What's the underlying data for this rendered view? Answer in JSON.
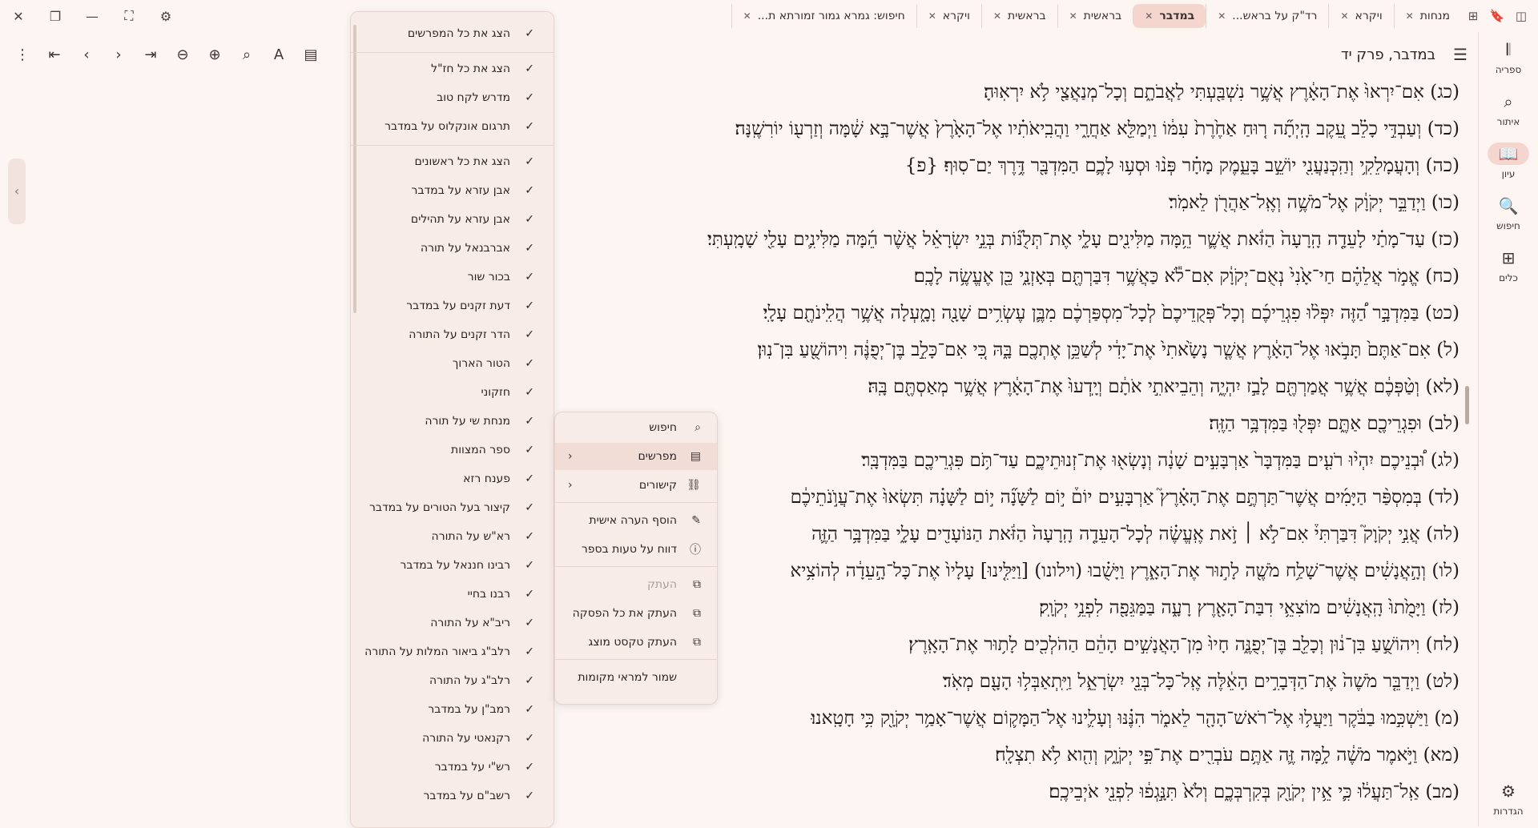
{
  "window": {
    "close": "✕",
    "restore": "❐",
    "minimize": "—",
    "fullscreen": "⛶",
    "settings": "⚙"
  },
  "tabbar": {
    "icons": [
      {
        "name": "sidebar-toggle-icon",
        "glyph": "◫"
      },
      {
        "name": "bookmark-icon",
        "glyph": "🔖"
      },
      {
        "name": "new-tab-icon",
        "glyph": "⊞"
      }
    ],
    "tabs": [
      {
        "label": "מנחות",
        "active": false
      },
      {
        "label": "ויקרא",
        "active": false
      },
      {
        "label": "רד\"ק על בראש...",
        "active": false
      },
      {
        "label": "במדבר",
        "active": true
      },
      {
        "label": "בראשית",
        "active": false
      },
      {
        "label": "בראשית",
        "active": false
      },
      {
        "label": "ויקרא",
        "active": false
      },
      {
        "label": "חיפוש: גמרא גמור זמורתא ת...",
        "active": false
      }
    ]
  },
  "rail": {
    "items": [
      {
        "label": "ספריה",
        "icon": "library-icon",
        "glyph": "𝄃",
        "active": false
      },
      {
        "label": "איתור",
        "icon": "locate-icon",
        "glyph": "⌕",
        "active": false
      },
      {
        "label": "עיון",
        "icon": "book-open-icon",
        "glyph": "📖",
        "active": true
      },
      {
        "label": "חיפוש",
        "icon": "search-icon",
        "glyph": "🔍",
        "active": false
      },
      {
        "label": "כלים",
        "icon": "tools-icon",
        "glyph": "⊞",
        "active": false
      }
    ],
    "settings": {
      "label": "הגדרות",
      "icon": "gear-icon",
      "glyph": "⚙"
    }
  },
  "toolbar": {
    "title": "במדבר, פרק יד",
    "menu_glyph": "☰",
    "left_icons": [
      {
        "name": "more-options-icon",
        "glyph": "⋮"
      },
      {
        "name": "first-page-icon",
        "glyph": "⇤"
      },
      {
        "name": "previous-icon",
        "glyph": "‹"
      },
      {
        "name": "next-icon",
        "glyph": "›"
      },
      {
        "name": "last-page-icon",
        "glyph": "⇥"
      },
      {
        "name": "zoom-out-icon",
        "glyph": "⊖"
      },
      {
        "name": "zoom-in-icon",
        "glyph": "⊕"
      },
      {
        "name": "search-icon",
        "glyph": "⌕"
      },
      {
        "name": "text-style-icon",
        "glyph": "A"
      },
      {
        "name": "panel-toggle-icon",
        "glyph": "▤"
      }
    ]
  },
  "verses": [
    "(כג) אִם־יִרְאוּ֙ אֶת־הָאָ֔רֶץ אֲשֶׁ֥ר נִשְׁבַּ֖עְתִּי לַאֲבֹתָ֑ם וְכָל־מְנַאֲצַ֖י לֹ֥א יִרְאֽוּהָ׃",
    "(כד) וְעַבְדִּ֣י כָלֵ֗ב עֵ֚קֶב הָֽיְתָ֞ה ר֤וּחַ אַחֶ֙רֶת֙ עִמּ֔וֹ וַיְמַלֵּ֖א אַחֲרָ֑י וַהֲבִֽיאֹתִ֗יו אֶל־הָאָ֙רֶץ֙ אֲשֶׁר־בָּ֣א שָׁ֔מָּה וְזַרְע֖וֹ יוֹרִשֶֽׁנָּה׃",
    "(כה) וְהָעֲמָלֵקִ֥י וְהַֽכְּנַעֲנִ֖י יוֹשֵׁ֣ב בָּעֵ֑מֶק מָחָ֗ר פְּנ֨וּ וּסְע֥וּ לָכֶ֛ם הַמִּדְבָּ֖ר דֶּ֥רֶךְ יַם־סֽוּף׃ {פ}",
    "(כו) וַיְדַבֵּ֣ר יְקֹוָ֔ק אֶל־מֹשֶׁ֥ה וְאֶֽל־אַהֲרֹ֖ן לֵאמֹֽר׃",
    "(כז) עַד־מָתַ֗י לָעֵדָ֤ה הָֽרָעָה֙ הַזֹּ֔את אֲשֶׁ֛ר הֵ֥מָּה מַלִּינִ֖ים עָלָ֑י אֶת־תְּלֻנּ֞וֹת בְּנֵ֣י יִשְׂרָאֵ֗ל אֲשֶׁ֨ר הֵ֜מָּה מַלִּינִ֛ים עָלַ֖י שָׁמָֽעְתִּי׃",
    "(כח) אֱמֹ֣ר אֲלֵהֶ֗ם חַי־אָ֙נִי֙ נְאֻם־יְקֹוָ֔ק אִם־לֹ֕א כַּאֲשֶׁ֥ר דִּבַּרְתֶּ֖ם בְּאָזְנָ֑י כֵּ֖ן אֶעֱשֶׂ֥ה לָכֶֽם׃",
    "(כט) בַּמִּדְבָּ֣ר הַ֠זֶּה יִפְּל֨וּ פִגְרֵיכֶ֜ם וְכָל־פְּקֻדֵיכֶם֙ לְכָל־מִסְפַּרְכֶ֔ם מִבֶּ֛ן עֶשְׂרִ֥ים שָׁנָ֖ה וָמָ֑עְלָה אֲשֶׁ֥ר הֲלִֽינֹתֶ֖ם עָלָֽי׃",
    "(ל) אִם־אַתֶּם֙ תָּבֹ֣אוּ אֶל־הָאָ֔רֶץ אֲשֶׁ֤ר נָשָׂ֙אתִי֙ אֶת־יָדִ֔י לְשַׁכֵּ֥ן אֶתְכֶ֖ם בָּ֑הּ כִּ֚י אִם־כָּלֵ֣ב בֶּן־יְפֻנֶּ֔ה וִיהוֹשֻׁ֖עַ בִּן־נֽוּן׃",
    "(לא) וְטַ֨פְּכֶ֔ם אֲשֶׁ֥ר אֲמַרְתֶּ֖ם לָבַ֣ז יִהְיֶ֑ה וְהֵבֵיאתִ֣י אֹתָ֔ם וְיָֽדְעוּ֙ אֶת־הָאָ֔רֶץ אֲשֶׁ֥ר מְאַסְתֶּ֖ם בָּֽהּ׃",
    "(לב) וּפִגְרֵיכֶ֖ם אַתֶּ֑ם יִפְּל֖וּ בַּמִּדְבָּ֥ר הַזֶּֽה׃",
    "(לג) וּ֠בְנֵיכֶם יִהְי֨וּ רֹעִ֤ים בַּמִּדְבָּר֙ אַרְבָּעִ֣ים שָׁנָ֔ה וְנָשְׂא֖וּ אֶת־זְנוּתֵיכֶ֑ם עַד־תֹּ֥ם פִּגְרֵיכֶ֖ם בַּמִּדְבָּֽר׃",
    "(לד) בְּמִסְפַּ֨ר הַיָּמִ֜ים אֲשֶׁר־תַּרְתֶּ֣ם אֶת־הָאָ֗רֶץ֮ אַרְבָּעִ֣ים יוֹם֒ י֣וֹם לַשָּׁנָ֞ה י֣וֹם לַשָּׁנָ֗ה תִּשְׂאוּ֙ אֶת־עֲוֺ֣נֹתֵיכֶ֔ם",
    "(לה) אֲנִ֣י יְקֹוָק֮ דִּבַּרְתִּי֒ אִם־לֹ֣א ׀ זֹ֣את אֶֽעֱשֶׂ֗ה לְכָל־הָעֵדָ֤ה הָֽרָעָה֙ הַזֹּ֔את הַנּוֹעָדִ֖ים עָלָ֑י בַּמִּדְבָּ֥ר הַזֶּ֛ה",
    "(לו) וְהָ֣אֲנָשִׁ֔ים אֲשֶׁר־שָׁלַ֥ח מֹשֶׁ֖ה לָת֣וּר אֶת־הָאָ֑רֶץ וַיָּשֻׁ֗בוּ (וילונו) [וַיַּלִּ֤ינוּ] עָלָיו֙ אֶת־כָּל־הָ֣עֵדָ֔ה לְהוֹצִ֥יא",
    "(לז) וַיָּמֻ֙תוּ֙ הָֽאֲנָשִׁ֔ים מוֹצִאֵ֥י דִבַּת־הָאָ֖רֶץ רָעָ֑ה בַּמַּגֵּפָ֖ה לִפְנֵ֥י יְקֹוָֽק׃",
    "(לח) וִיהוֹשֻׁ֣עַ בִּן־נ֔וּן וְכָלֵ֖ב בֶּן־יְפֻנֶּ֑ה חָיוּ֙ מִן־הָאֲנָשִׁ֣ים הָהֵ֔ם הַהֹלְכִ֖ים לָת֥וּר אֶת־הָאָֽרֶץ׃",
    "(לט) וַיְדַבֵּ֤ר מֹשֶׁה֙ אֶת־הַדְּבָרִ֣ים הָאֵ֔לֶּה אֶֽל־כָּל־בְּנֵ֖י יִשְׂרָאֵ֑ל וַיִּֽתְאַבְּל֥וּ הָעָ֖ם מְאֹֽד׃",
    "(מ) וַיַּשְׁכִּ֣מוּ בַבֹּ֔קֶר וַיַּעֲל֥וּ אֶל־רֹאשׁ־הָהָ֖ר לֵאמֹ֑ר הִנֶּ֗נּוּ וְעָלִ֛ינוּ אֶל־הַמָּק֛וֹם אֲשֶׁר־אָמַ֥ר יְקֹוָ֖ק כִּ֥י חָטָֽאנוּ׃",
    "(מא) וַיֹּ֣אמֶר מֹשֶׁ֔ה לָ֥מָּה זֶּ֛ה אַתֶּ֥ם עֹבְרִ֖ים אֶת־פִּ֣י יְקֹוָ֑ק וְהִ֖וא לֹ֥א תִצְלָֽח׃",
    "(מב) אַֽל־תַּעֲל֔וּ כִּ֛י אֵ֥ין יְקֹוָ֖ק בְּקִרְבְּכֶ֑ם וְלֹא֙ תִּנָּ֣גְפ֔וּ לִפְנֵ֖י אֹיְבֵיכֶֽם׃"
  ],
  "commentators": {
    "check": "✓",
    "groups": [
      [
        "הצג את כל המפרשים"
      ],
      [
        "הצג את כל חז\"ל",
        "מדרש לקח טוב",
        "תרגום אונקלוס על במדבר"
      ],
      [
        "הצג את כל ראשונים",
        "אבן עזרא על במדבר",
        "אבן עזרא על תהילים",
        "אברבנאל על תורה",
        "בכור שור",
        "דעת זקנים על במדבר",
        "הדר זקנים על התורה",
        "הטור הארוך",
        "חזקוני",
        "מנחת שי על תורה",
        "ספר המצוות",
        "פענח רזא",
        "קיצור בעל הטורים על במדבר",
        "רא\"ש על התורה",
        "רבינו חננאל על במדבר",
        "רבנו בחיי",
        "ריב\"א על התורה",
        "רלב\"ג ביאור המלות על התורה",
        "רלב\"ג על התורה",
        "רמב\"ן על במדבר",
        "רקנאטי על התורה",
        "רש\"י על במדבר",
        "רשב\"ם על במדבר"
      ]
    ]
  },
  "context_menu": {
    "items": [
      {
        "label": "חיפוש",
        "icon": "search-icon",
        "glyph": "⌕",
        "arrow": "",
        "highlight": false,
        "disabled": false
      },
      {
        "label": "מפרשים",
        "icon": "commentary-icon",
        "glyph": "▤",
        "arrow": "‹",
        "highlight": true,
        "disabled": false
      },
      {
        "label": "קישורים",
        "icon": "link-icon",
        "glyph": "⛓",
        "arrow": "‹",
        "highlight": false,
        "disabled": false
      },
      {
        "label": "הוסף הערה אישית",
        "icon": "add-note-icon",
        "glyph": "✎",
        "arrow": "",
        "highlight": false,
        "disabled": false
      },
      {
        "label": "דווח על טעות בספר",
        "icon": "report-icon",
        "glyph": "ⓘ",
        "arrow": "",
        "highlight": false,
        "disabled": false
      },
      {
        "label": "העתק",
        "icon": "copy-icon",
        "glyph": "⧉",
        "arrow": "",
        "highlight": false,
        "disabled": true
      },
      {
        "label": "העתק את כל הפסקה",
        "icon": "copy-paragraph-icon",
        "glyph": "⧉",
        "arrow": "",
        "highlight": false,
        "disabled": false
      },
      {
        "label": "העתק טקסט מוצג",
        "icon": "copy-displayed-icon",
        "glyph": "⧉",
        "arrow": "",
        "highlight": false,
        "disabled": false
      },
      {
        "label": "שמור למראי מקומות",
        "icon": "",
        "glyph": "",
        "arrow": "",
        "highlight": false,
        "disabled": false
      }
    ]
  }
}
